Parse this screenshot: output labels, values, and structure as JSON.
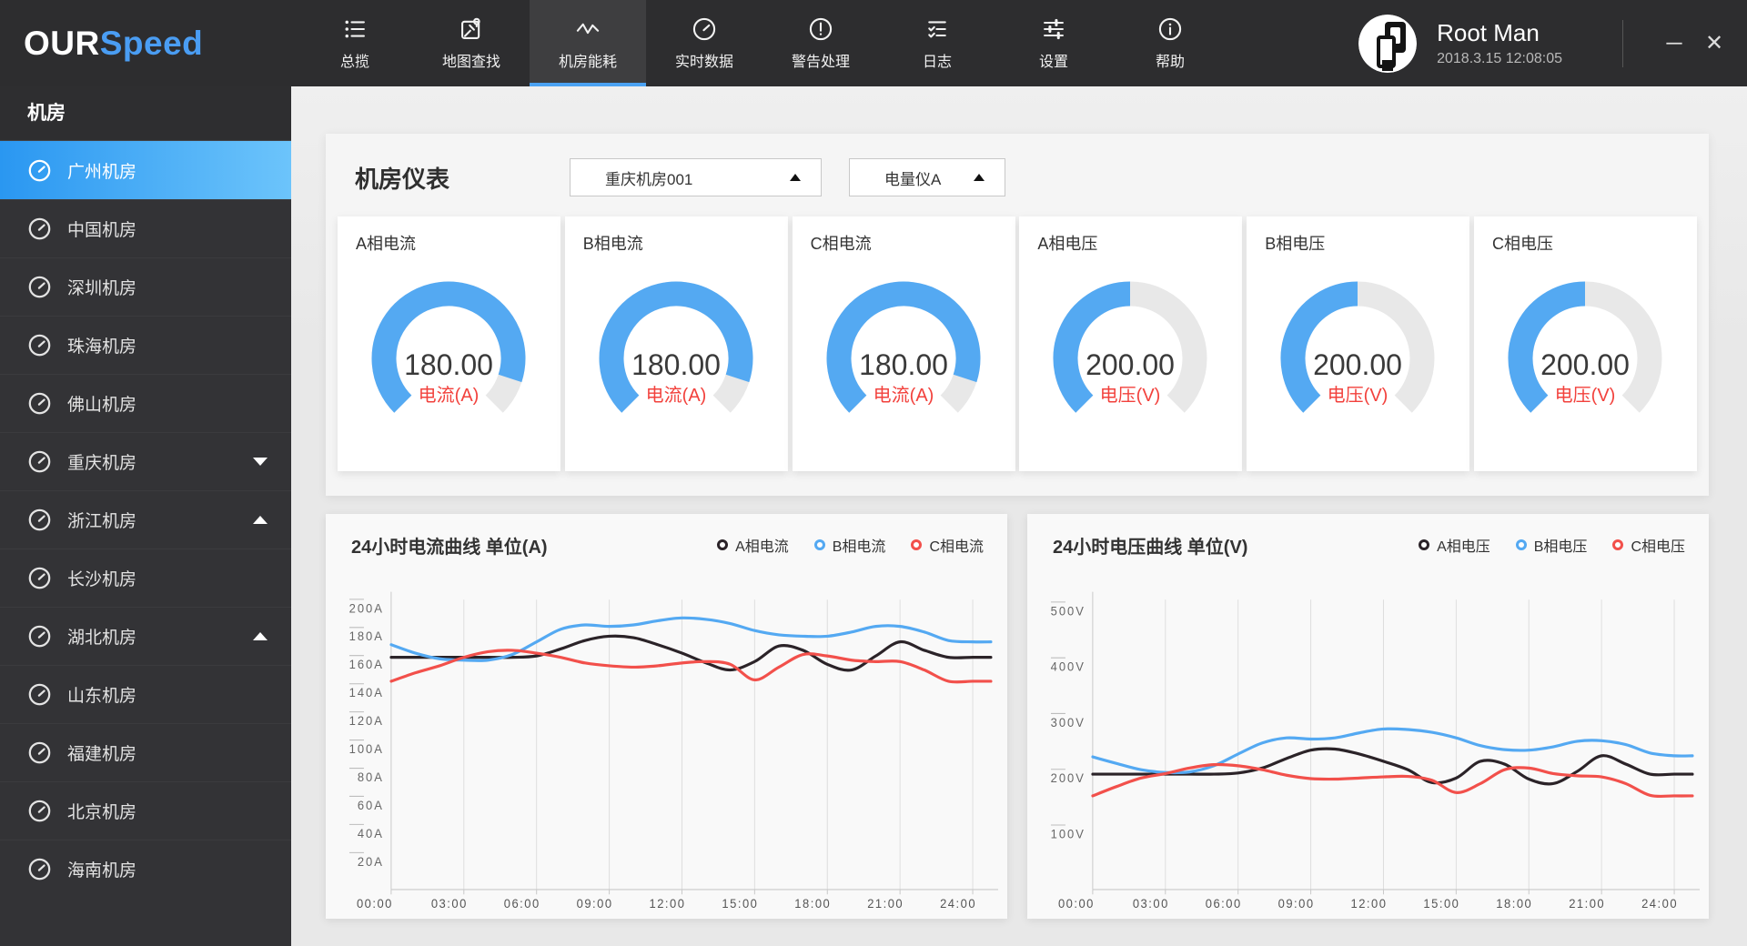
{
  "colors": {
    "accent_blue": "#54a9f2",
    "red": "#f2504b",
    "dark_series": "#2b2328",
    "red_label": "#f2413c",
    "gauge_track": "#e8e8e8",
    "active_underline": "#4ba2f2",
    "sidebar_selected_gradient": [
      "#2a97f1",
      "#6cc4fb"
    ]
  },
  "topbar": {
    "logo": {
      "part1": "OUR",
      "part2": "Speed"
    },
    "nav": [
      {
        "id": "overview",
        "label": "总揽",
        "icon": "list",
        "active": false
      },
      {
        "id": "map-search",
        "label": "地图查找",
        "icon": "map-search",
        "active": false
      },
      {
        "id": "room-energy",
        "label": "机房能耗",
        "icon": "pulse",
        "active": true
      },
      {
        "id": "realtime",
        "label": "实时数据",
        "icon": "gauge",
        "active": false
      },
      {
        "id": "alerts",
        "label": "警告处理",
        "icon": "alert",
        "active": false
      },
      {
        "id": "logs",
        "label": "日志",
        "icon": "log",
        "active": false
      },
      {
        "id": "settings",
        "label": "设置",
        "icon": "sliders",
        "active": false
      },
      {
        "id": "help",
        "label": "帮助",
        "icon": "info",
        "active": false
      }
    ],
    "user": {
      "name": "Root Man",
      "datetime": "2018.3.15 12:08:05"
    }
  },
  "sidebar": {
    "header": "机房",
    "items": [
      {
        "label": "广州机房",
        "active": true,
        "arrow": null
      },
      {
        "label": "中国机房",
        "active": false,
        "arrow": null
      },
      {
        "label": "深圳机房",
        "active": false,
        "arrow": null
      },
      {
        "label": "珠海机房",
        "active": false,
        "arrow": null
      },
      {
        "label": "佛山机房",
        "active": false,
        "arrow": null
      },
      {
        "label": "重庆机房",
        "active": false,
        "arrow": "down"
      },
      {
        "label": "浙江机房",
        "active": false,
        "arrow": "up"
      },
      {
        "label": "长沙机房",
        "active": false,
        "arrow": null
      },
      {
        "label": "湖北机房",
        "active": false,
        "arrow": "up"
      },
      {
        "label": "山东机房",
        "active": false,
        "arrow": null
      },
      {
        "label": "福建机房",
        "active": false,
        "arrow": null
      },
      {
        "label": "北京机房",
        "active": false,
        "arrow": null
      },
      {
        "label": "海南机房",
        "active": false,
        "arrow": null
      }
    ]
  },
  "main": {
    "gauges_panel": {
      "title": "机房仪表",
      "selects": [
        {
          "value": "重庆机房001"
        },
        {
          "value": "电量仪A"
        }
      ],
      "gauges": [
        {
          "title": "A相电流",
          "value": "180.00",
          "unit_label": "电流(A)",
          "arc_percent": 90
        },
        {
          "title": "B相电流",
          "value": "180.00",
          "unit_label": "电流(A)",
          "arc_percent": 90
        },
        {
          "title": "C相电流",
          "value": "180.00",
          "unit_label": "电流(A)",
          "arc_percent": 90
        },
        {
          "title": "A相电压",
          "value": "200.00",
          "unit_label": "电压(V)",
          "arc_percent": 50
        },
        {
          "title": "B相电压",
          "value": "200.00",
          "unit_label": "电压(V)",
          "arc_percent": 50
        },
        {
          "title": "C相电压",
          "value": "200.00",
          "unit_label": "电压(V)",
          "arc_percent": 50
        }
      ]
    }
  },
  "chart_data": [
    {
      "type": "line",
      "title": "24小时电流曲线 单位(A)",
      "x_hours": [
        0,
        1,
        2,
        3,
        4,
        5,
        6,
        7,
        8,
        9,
        10,
        11,
        12,
        13,
        14,
        15,
        16,
        17,
        18,
        19,
        20,
        21,
        22,
        23,
        24
      ],
      "x_tick_labels": [
        "00:00",
        "03:00",
        "06:00",
        "09:00",
        "12:00",
        "15:00",
        "18:00",
        "21:00",
        "24:00"
      ],
      "x_tick_hours": [
        0,
        3,
        6,
        9,
        12,
        15,
        18,
        21,
        24
      ],
      "y_ticks": [
        {
          "v": 20,
          "label": "20A"
        },
        {
          "v": 40,
          "label": "40A"
        },
        {
          "v": 60,
          "label": "60A"
        },
        {
          "v": 80,
          "label": "80A"
        },
        {
          "v": 100,
          "label": "100A"
        },
        {
          "v": 120,
          "label": "120A"
        },
        {
          "v": 140,
          "label": "140A"
        },
        {
          "v": 160,
          "label": "160A"
        },
        {
          "v": 180,
          "label": "180A"
        },
        {
          "v": 200,
          "label": "200A"
        }
      ],
      "ylim": [
        0,
        206
      ],
      "grid": "vertical-only",
      "legend_position": "top-right",
      "series": [
        {
          "name": "A相电流",
          "color": "#2b2328",
          "values": [
            165,
            165,
            165,
            165,
            165,
            165,
            166,
            171,
            177,
            180,
            179,
            174,
            168,
            161,
            156,
            162,
            173,
            170,
            160,
            156,
            166,
            176,
            170,
            165,
            165
          ]
        },
        {
          "name": "B相电流",
          "color": "#54a9f2",
          "values": [
            174,
            168,
            164,
            163,
            163,
            167,
            176,
            185,
            188,
            187,
            188,
            191,
            193,
            192,
            189,
            184,
            181,
            180,
            180,
            183,
            187,
            187,
            183,
            177,
            176
          ]
        },
        {
          "name": "C相电流",
          "color": "#f2504b",
          "values": [
            148,
            154,
            159,
            165,
            169,
            170,
            168,
            165,
            161,
            159,
            158,
            159,
            161,
            162,
            160,
            149,
            158,
            167,
            166,
            163,
            162,
            162,
            156,
            148,
            148
          ]
        }
      ]
    },
    {
      "type": "line",
      "title": "24小时电压曲线 单位(V)",
      "x_hours": [
        0,
        1,
        2,
        3,
        4,
        5,
        6,
        7,
        8,
        9,
        10,
        11,
        12,
        13,
        14,
        15,
        16,
        17,
        18,
        19,
        20,
        21,
        22,
        23,
        24
      ],
      "x_tick_labels": [
        "00:00",
        "03:00",
        "06:00",
        "09:00",
        "12:00",
        "15:00",
        "18:00",
        "21:00",
        "24:00"
      ],
      "x_tick_hours": [
        0,
        3,
        6,
        9,
        12,
        15,
        18,
        21,
        24
      ],
      "y_ticks": [
        {
          "v": 100,
          "label": "100V"
        },
        {
          "v": 200,
          "label": "200V"
        },
        {
          "v": 300,
          "label": "300V"
        },
        {
          "v": 400,
          "label": "400V"
        },
        {
          "v": 500,
          "label": "500V"
        }
      ],
      "ylim": [
        0,
        520
      ],
      "grid": "vertical-only",
      "legend_position": "top-right",
      "series": [
        {
          "name": "A相电压",
          "color": "#2b2328",
          "values": [
            207,
            207,
            207,
            207,
            207,
            207,
            209,
            218,
            235,
            250,
            252,
            243,
            230,
            215,
            192,
            200,
            230,
            225,
            198,
            190,
            212,
            240,
            225,
            207,
            207
          ]
        },
        {
          "name": "B相电压",
          "color": "#54a9f2",
          "values": [
            238,
            226,
            215,
            210,
            211,
            222,
            243,
            263,
            272,
            270,
            272,
            281,
            288,
            287,
            282,
            272,
            258,
            251,
            250,
            256,
            266,
            267,
            260,
            245,
            240
          ]
        },
        {
          "name": "C相电压",
          "color": "#f2504b",
          "values": [
            168,
            185,
            200,
            208,
            218,
            224,
            222,
            215,
            205,
            199,
            198,
            200,
            202,
            203,
            196,
            174,
            190,
            215,
            218,
            208,
            204,
            202,
            190,
            169,
            168
          ]
        }
      ]
    }
  ]
}
